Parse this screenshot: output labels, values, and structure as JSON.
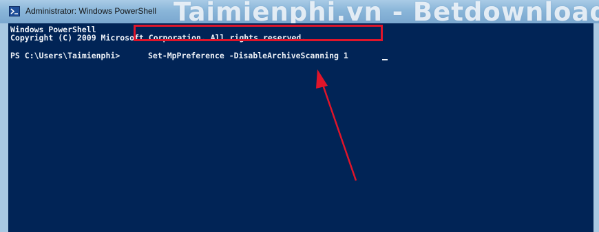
{
  "window": {
    "title": "Administrator: Windows PowerShell",
    "watermark": "Taimienphi.vn - Betdownload.com"
  },
  "console": {
    "line1": "Windows PowerShell",
    "line2": "Copyright (C) 2009 Microsoft Corporation. All rights reserved.",
    "prompt": "PS C:\\Users\\Taimienphi>",
    "command": "Set-MpPreference -DisableArchiveScanning 1"
  },
  "colors": {
    "console_bg": "#012456",
    "text": "#eef2f8",
    "highlight": "#e0152a",
    "arrow": "#e0152a"
  },
  "icons": {
    "title_icon": "powershell-icon",
    "annotation": "arrow-up-icon"
  }
}
